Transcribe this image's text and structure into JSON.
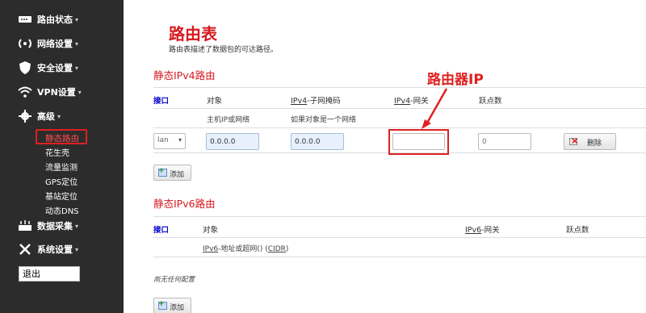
{
  "sidebar": {
    "items": [
      {
        "label": "路由状态",
        "icon": "router-status-icon"
      },
      {
        "label": "网络设置",
        "icon": "network-icon"
      },
      {
        "label": "安全设置",
        "icon": "shield-icon"
      },
      {
        "label": "VPN设置",
        "icon": "wifi-icon"
      },
      {
        "label": "高级",
        "icon": "gear-icon"
      },
      {
        "label": "数据采集",
        "icon": "data-collection-icon"
      },
      {
        "label": "系统设置",
        "icon": "tools-icon"
      }
    ],
    "sub_items": [
      "静态路由",
      "花生壳",
      "流量监测",
      "GPS定位",
      "基站定位",
      "动态DNS"
    ],
    "logout_label": "退出"
  },
  "page": {
    "title": "路由表",
    "description": "路由表描述了数据包的可达路径。"
  },
  "ipv4": {
    "section_title": "静态IPv4路由",
    "headers": {
      "interface": "接口",
      "target": "对象",
      "netmask_prefix": "IPv4",
      "netmask_suffix": "-子网掩码",
      "gateway_prefix": "IPv4",
      "gateway_suffix": "-网关",
      "metric": "跃点数"
    },
    "hints": {
      "target": "主机IP或网络",
      "netmask": "如果对象是一个网络"
    },
    "row": {
      "interface": "lan",
      "target": "0.0.0.0",
      "netmask": "0.0.0.0",
      "gateway": "",
      "metric_placeholder": "0",
      "delete_label": "删除"
    },
    "add_label": "添加"
  },
  "ipv6": {
    "section_title": "静态IPv6路由",
    "headers": {
      "interface": "接口",
      "target": "对象",
      "gateway_prefix": "IPv6",
      "gateway_suffix": "-网关",
      "metric": "跃点数"
    },
    "hint_prefix": "IPv6",
    "hint_middle": "-地址或超网() (",
    "hint_cidr": "CIDR",
    "hint_suffix": ")",
    "empty_text": "尚无任何配置",
    "add_label": "添加"
  },
  "annotation": {
    "label": "路由器IP",
    "color": "#e02020"
  },
  "colors": {
    "accent": "#d71920",
    "sidebar_bg": "#2c2c2c",
    "link_blue": "#0000cc"
  }
}
